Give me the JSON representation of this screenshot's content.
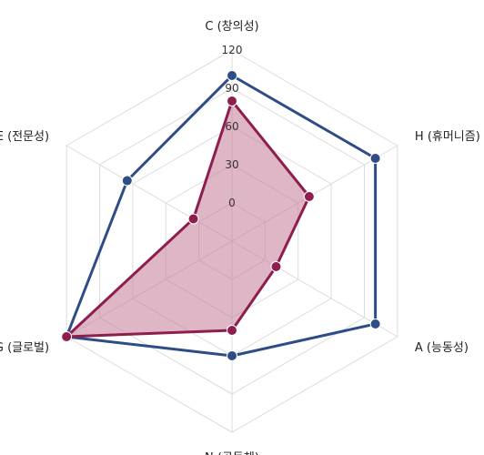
{
  "chart_data": {
    "type": "radar",
    "axes": [
      "C (창의성)",
      "H (휴머니즘)",
      "A (능동성)",
      "N (공동체)",
      "G (글로벌)",
      "E (전문성)"
    ],
    "tick_values": [
      0,
      30,
      60,
      90,
      120
    ],
    "tick_labels": [
      "0",
      "30",
      "60",
      "90",
      "120"
    ],
    "range": [
      -30,
      120
    ],
    "grid": true,
    "series": [
      {
        "values": [
          100,
          100,
          100,
          60,
          120,
          65
        ],
        "color": "#2e4c86",
        "fill": "none"
      },
      {
        "values": [
          80,
          40,
          10,
          40,
          120,
          5
        ],
        "color": "#8e1e4f",
        "fill": "#c47a98"
      }
    ]
  }
}
